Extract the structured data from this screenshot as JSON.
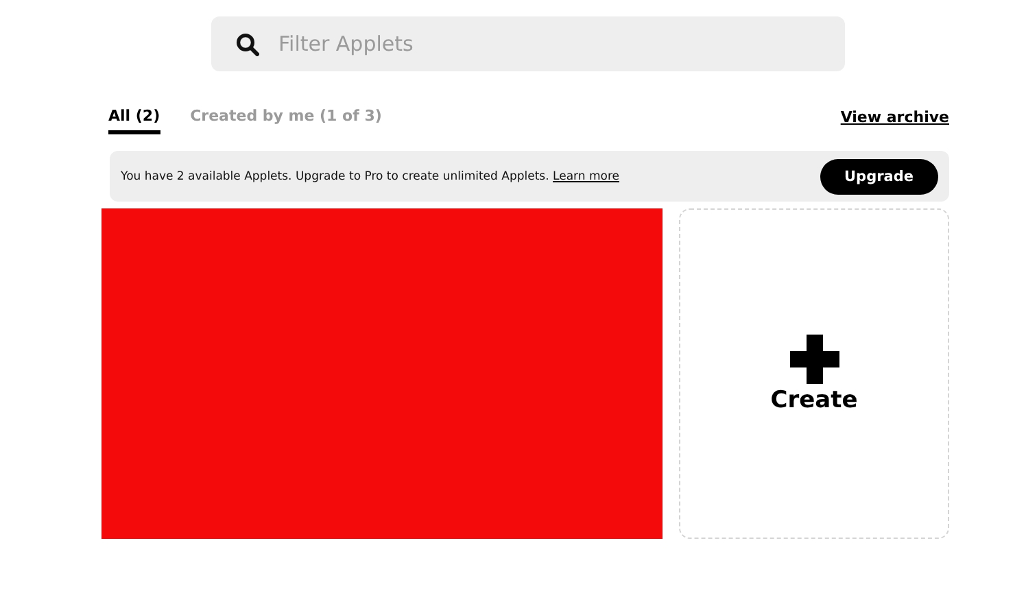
{
  "search": {
    "placeholder": "Filter Applets"
  },
  "tabs": [
    {
      "label": "All (2)",
      "selected": true
    },
    {
      "label": "Created by me (1 of 3)",
      "selected": false
    }
  ],
  "archive_link": "View archive",
  "banner": {
    "message": "You have 2 available Applets. Upgrade to Pro to create unlimited Applets.",
    "link": "Learn more",
    "button": "Upgrade"
  },
  "create_card": {
    "label": "Create"
  }
}
